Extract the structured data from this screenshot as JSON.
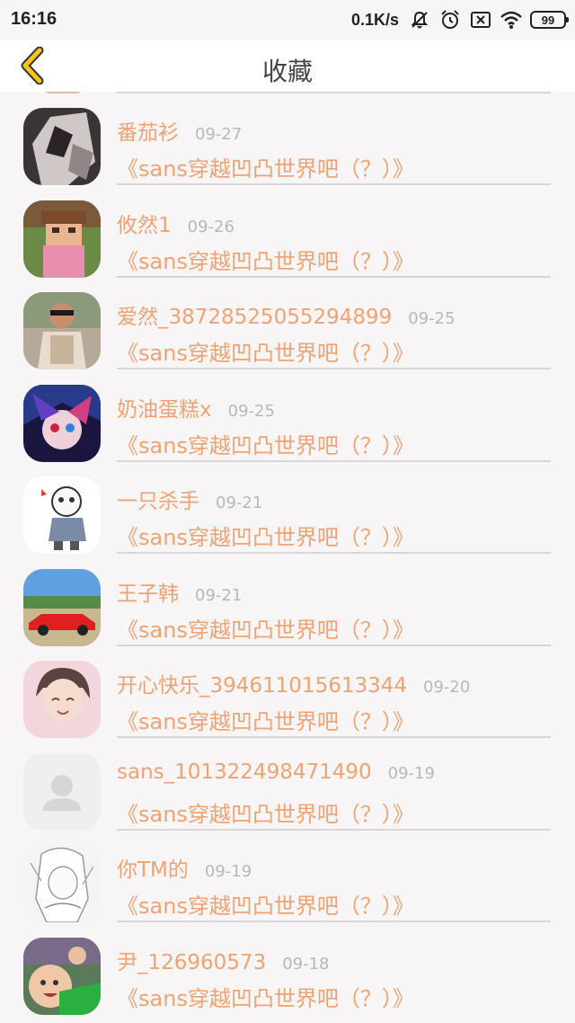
{
  "status_bar": {
    "time": "16:16",
    "net_speed": "0.1K/s",
    "battery": "99",
    "icons": [
      "mute-bell-icon",
      "alarm-clock-icon",
      "no-sim-icon",
      "wifi-icon",
      "battery-icon"
    ]
  },
  "header": {
    "title": "收藏",
    "back_icon": "chevron-left-icon"
  },
  "colors": {
    "accent": "#f0a372",
    "back_arrow": "#f5c518",
    "date": "#b8b8b8",
    "divider": "#d7d7d7"
  },
  "items": [
    {
      "user": "番茄衫",
      "date": "09-27",
      "title": "《sans穿越凹凸世界吧（？）》"
    },
    {
      "user": "攸然1",
      "date": "09-26",
      "title": "《sans穿越凹凸世界吧（？）》"
    },
    {
      "user": "爱然_38728525055294899",
      "date": "09-25",
      "title": "《sans穿越凹凸世界吧（？）》"
    },
    {
      "user": "奶油蛋糕x",
      "date": "09-25",
      "title": "《sans穿越凹凸世界吧（？）》"
    },
    {
      "user": "一只杀手",
      "date": "09-21",
      "title": "《sans穿越凹凸世界吧（？）》"
    },
    {
      "user": "王子韩",
      "date": "09-21",
      "title": "《sans穿越凹凸世界吧（？）》"
    },
    {
      "user": "开心快乐_394611015613344",
      "date": "09-20",
      "title": "《sans穿越凹凸世界吧（？）》"
    },
    {
      "user": "sans_101322498471490",
      "date": "09-19",
      "title": "《sans穿越凹凸世界吧（？）》"
    },
    {
      "user": "你TM的",
      "date": "09-19",
      "title": "《sans穿越凹凸世界吧（？）》"
    },
    {
      "user": "尹_126960573",
      "date": "09-18",
      "title": "《sans穿越凹凸世界吧（？）》"
    }
  ]
}
